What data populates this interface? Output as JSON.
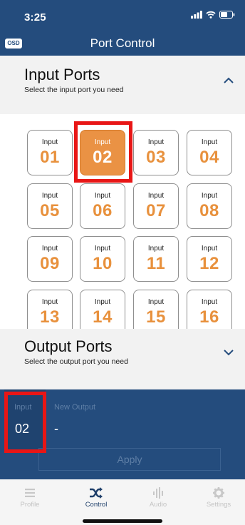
{
  "status": {
    "time": "3:25"
  },
  "header": {
    "badge": "OSD",
    "title": "Port Control"
  },
  "input_section": {
    "title": "Input Ports",
    "subtitle": "Select the input port you need"
  },
  "input_ports": [
    {
      "label": "Input",
      "number": "01"
    },
    {
      "label": "Input",
      "number": "02",
      "selected": true
    },
    {
      "label": "Input",
      "number": "03"
    },
    {
      "label": "Input",
      "number": "04"
    },
    {
      "label": "Input",
      "number": "05"
    },
    {
      "label": "Input",
      "number": "06"
    },
    {
      "label": "Input",
      "number": "07"
    },
    {
      "label": "Input",
      "number": "08"
    },
    {
      "label": "Input",
      "number": "09"
    },
    {
      "label": "Input",
      "number": "10"
    },
    {
      "label": "Input",
      "number": "11"
    },
    {
      "label": "Input",
      "number": "12"
    },
    {
      "label": "Input",
      "number": "13"
    },
    {
      "label": "Input",
      "number": "14"
    },
    {
      "label": "Input",
      "number": "15"
    },
    {
      "label": "Input",
      "number": "16"
    }
  ],
  "output_section": {
    "title": "Output Ports",
    "subtitle": "Select the output port you need"
  },
  "routing": {
    "input_label": "Input",
    "input_value": "02",
    "output_label": "New Output",
    "output_value": "-",
    "apply_label": "Apply"
  },
  "tabs": [
    {
      "label": "Profile",
      "icon": "list-icon"
    },
    {
      "label": "Control",
      "icon": "shuffle-icon",
      "active": true
    },
    {
      "label": "Audio",
      "icon": "audio-bars-icon"
    },
    {
      "label": "Settings",
      "icon": "gear-icon"
    }
  ],
  "colors": {
    "brand_blue": "#244c7d",
    "accent_orange": "#e8913d",
    "highlight_red": "#e81616"
  }
}
